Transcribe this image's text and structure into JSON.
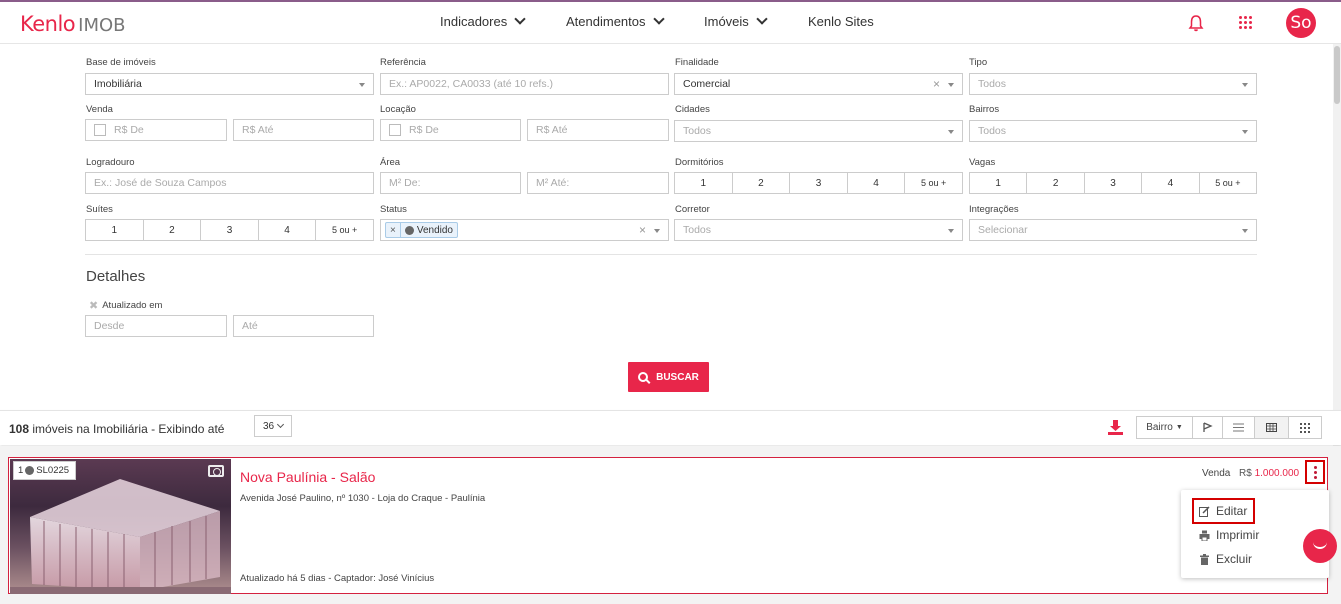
{
  "app": {
    "logo_brand": "Kenlo",
    "logo_product": "IMOB",
    "avatar": "So"
  },
  "nav": [
    {
      "label": "Indicadores"
    },
    {
      "label": "Atendimentos"
    },
    {
      "label": "Imóveis"
    },
    {
      "label": "Kenlo Sites"
    }
  ],
  "filters": {
    "base_label": "Base de imóveis",
    "base_value": "Imobiliária",
    "ref_label": "Referência",
    "ref_placeholder": "Ex.: AP0022, CA0033 (até 10 refs.)",
    "finalidade_label": "Finalidade",
    "finalidade_value": "Comercial",
    "tipo_label": "Tipo",
    "tipo_value": "Todos",
    "venda_label": "Venda",
    "venda_de": "R$ De",
    "venda_ate": "R$ Até",
    "locacao_label": "Locação",
    "locacao_de": "R$ De",
    "locacao_ate": "R$ Até",
    "cidades_label": "Cidades",
    "cidades_value": "Todos",
    "bairros_label": "Bairros",
    "bairros_value": "Todos",
    "logradouro_label": "Logradouro",
    "logradouro_placeholder": "Ex.: José de Souza Campos",
    "area_label": "Área",
    "area_de": "M² De:",
    "area_ate": "M² Até:",
    "dormitorios_label": "Dormitórios",
    "vagas_label": "Vagas",
    "suites_label": "Suítes",
    "counts": [
      "1",
      "2",
      "3",
      "4",
      "5 ou +"
    ],
    "status_label": "Status",
    "status_tag": "Vendido",
    "status_tag_x": "×",
    "corretor_label": "Corretor",
    "corretor_value": "Todos",
    "integracoes_label": "Integrações",
    "integracoes_value": "Selecionar"
  },
  "detalhes": {
    "title": "Detalhes",
    "atualizado_label": "Atualizado em",
    "desde": "Desde",
    "ate": "Até"
  },
  "search_button": "BUSCAR",
  "results": {
    "count": "108",
    "count_text": " imóveis na Imobiliária - Exibindo até",
    "per_page": "36",
    "sort": "Bairro"
  },
  "listing": {
    "index": "1",
    "code": "SL0225",
    "title": "Nova Paulínia - Salão",
    "address": "Avenida José Paulino, nº 1030 - Loja do Craque - Paulínia",
    "footer": "Atualizado há 5 dias - Captador: José Vinícius",
    "deal": "Venda",
    "currency": "R$",
    "price": "1.000.000"
  },
  "menu": [
    {
      "label": "Editar",
      "icon": "edit-icon"
    },
    {
      "label": "Imprimir",
      "icon": "print-icon"
    },
    {
      "label": "Excluir",
      "icon": "trash-icon"
    }
  ],
  "colors": {
    "accent": "#e8264a",
    "highlight": "#d40000"
  }
}
